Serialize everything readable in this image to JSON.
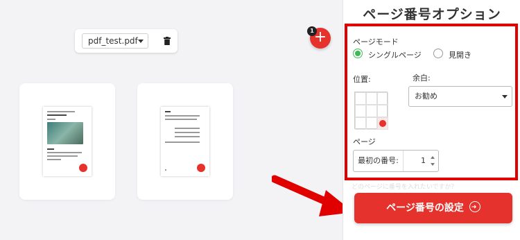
{
  "toolbar": {
    "file_name": "pdf_test.pdf",
    "add_badge": "1"
  },
  "sidebar": {
    "title": "ページ番号オプション",
    "page_mode_label": "ページモード",
    "modes": [
      {
        "label": "シングルページ",
        "checked": true
      },
      {
        "label": "見開き",
        "checked": false
      }
    ],
    "position_label": "位置:",
    "margin_label": "余白:",
    "margin_value": "お勧め",
    "pages_label": "ページ",
    "first_number_label": "最初の番号:",
    "first_number_value": "1",
    "faded_text": "どのページに番号を入れたいですか？",
    "submit_label": "ページ番号の設定"
  },
  "colors": {
    "accent": "#e5322d",
    "highlight_border": "#e00000",
    "radio_checked": "#3cba54"
  }
}
